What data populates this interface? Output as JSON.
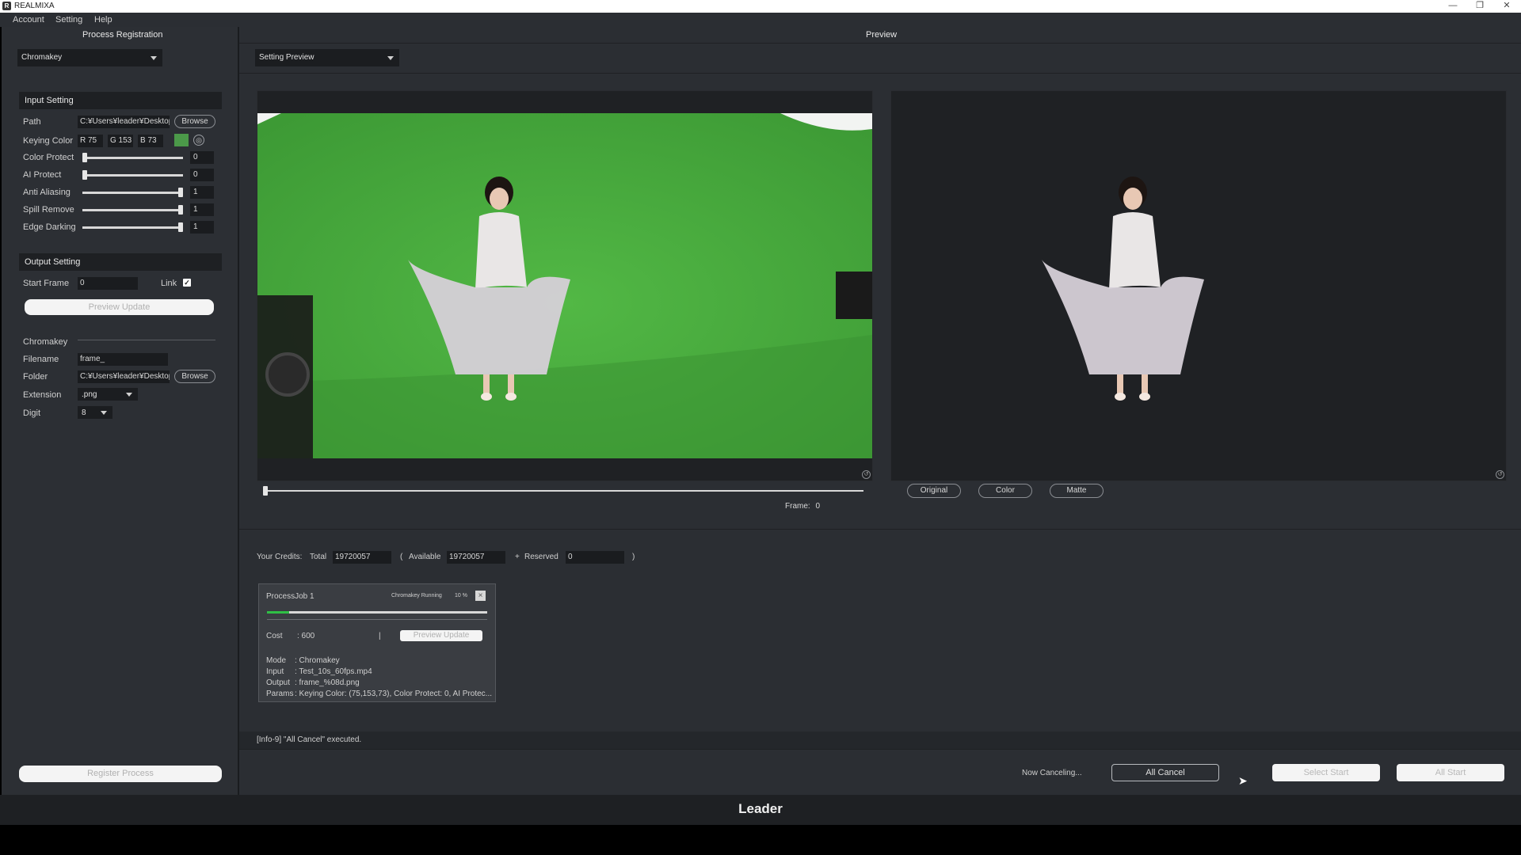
{
  "window": {
    "title": "REALMIXA",
    "logo": "R"
  },
  "menu": [
    "Account",
    "Setting",
    "Help"
  ],
  "left_panel": {
    "title": "Process Registration",
    "process_dropdown": "Chromakey",
    "input_setting": {
      "header": "Input Setting",
      "path_label": "Path",
      "path_value": "C:¥Users¥leader¥Desktop",
      "browse_label": "Browse",
      "keying_color_label": "Keying Color",
      "r": "R 75",
      "g": "G 153",
      "b": "B 73",
      "swatch_color": "#4b9949",
      "sliders": [
        {
          "label": "Color Protect",
          "value": "0",
          "level": 0.0
        },
        {
          "label": "AI Protect",
          "value": "0",
          "level": 0.0
        },
        {
          "label": "Anti Aliasing",
          "value": "1",
          "level": 1.0
        },
        {
          "label": "Spill Remove",
          "value": "1",
          "level": 1.0
        },
        {
          "label": "Edge Darking",
          "value": "1",
          "level": 1.0
        }
      ]
    },
    "output_setting": {
      "header": "Output Setting",
      "start_frame_label": "Start Frame",
      "start_frame_value": "0",
      "link_label": "Link",
      "link_checked": "✓",
      "preview_update": "Preview Update",
      "chromakey_label": "Chromakey",
      "filename_label": "Filename",
      "filename_value": "frame_",
      "folder_label": "Folder",
      "folder_value": "C:¥Users¥leader¥Desktop",
      "browse_label": "Browse",
      "extension_label": "Extension",
      "extension_value": ".png",
      "digit_label": "Digit",
      "digit_value": "8"
    },
    "register_process": "Register Process"
  },
  "preview": {
    "title": "Preview",
    "mode_dropdown": "Setting Preview",
    "arrow": ">",
    "frame_label": "Frame:",
    "frame_value": "0",
    "view_buttons": [
      "Original",
      "Color",
      "Matte"
    ]
  },
  "credits": {
    "label": "Your Credits:",
    "total_label": "Total",
    "total_value": "19720057",
    "open_paren": "(",
    "available_label": "Available",
    "available_value": "19720057",
    "plus": "+",
    "reserved_label": "Reserved",
    "reserved_value": "0",
    "close_paren": ")"
  },
  "job": {
    "name": "ProcessJob 1",
    "status": "Chromakey Running",
    "percent_text": "10 %",
    "progress": 0.1,
    "close": "×",
    "cost_label": "Cost",
    "cost_value": ": 600",
    "separator": "|",
    "preview_update": "Preview Update",
    "mode_label": "Mode",
    "mode_value": ": Chromakey",
    "input_label": "Input",
    "input_value": ": Test_10s_60fps.mp4",
    "output_label": "Output",
    "output_value": ": frame_%08d.png",
    "params_label": "Params",
    "params_value": ": Keying Color: (75,153,73), Color Protect: 0, AI Protec..."
  },
  "status_message": "[Info-9] \"All Cancel\" executed.",
  "bottom_actions": {
    "now_canceling": "Now Canceling...",
    "all_cancel": "All Cancel",
    "select_start": "Select Start",
    "all_start": "All Start"
  },
  "brand": "Leader"
}
